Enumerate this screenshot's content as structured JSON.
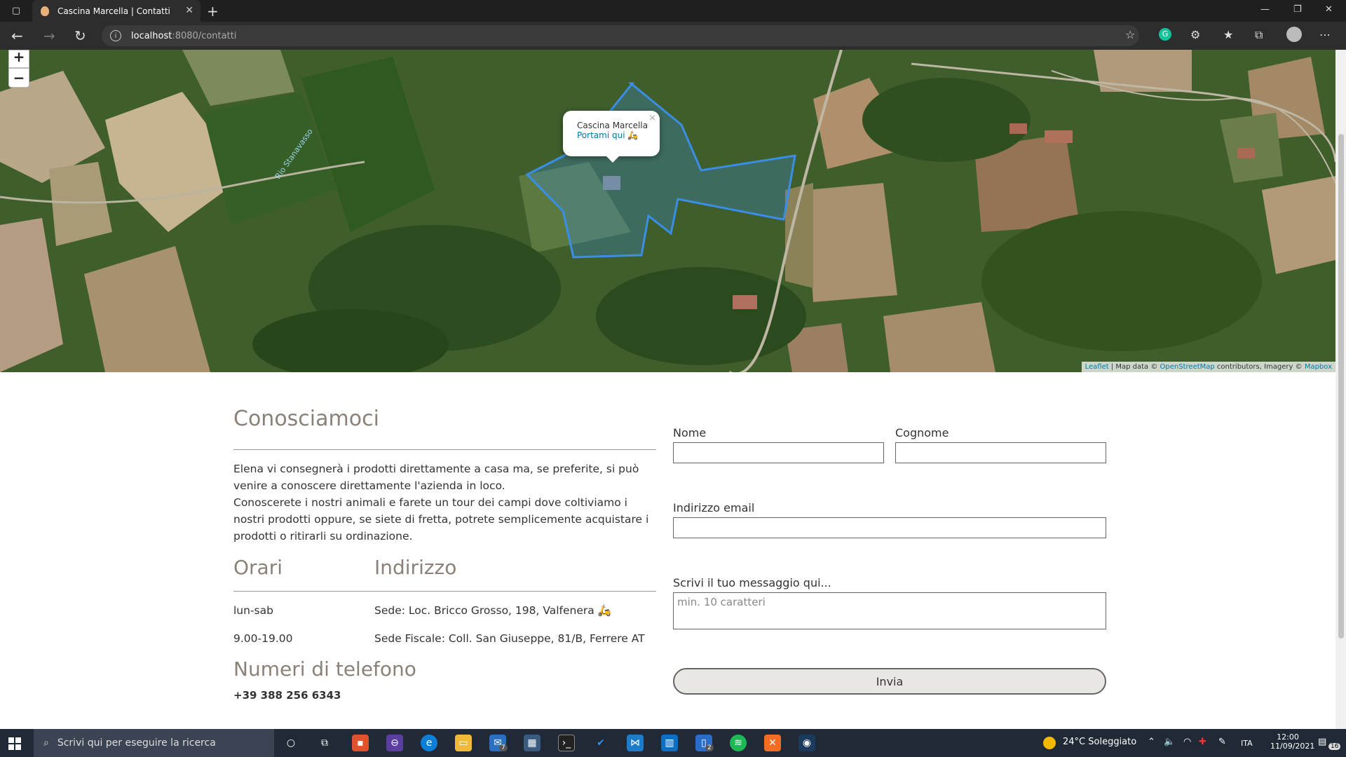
{
  "browser": {
    "tab_title": "Cascina Marcella | Contatti",
    "url_host": "localhost",
    "url_rest": ":8080/contatti"
  },
  "map": {
    "zoom_in": "+",
    "zoom_out": "−",
    "river_label": "Rio Stanavasso",
    "popup_title": "Cascina Marcella",
    "popup_link": "Portami qui 🛵",
    "popup_close": "×",
    "attrib_leaflet": "Leaflet",
    "attrib_mid": " | Map data © ",
    "attrib_osm": "OpenStreetMap",
    "attrib_contrib": " contributors, Imagery © ",
    "attrib_mapbox": "Mapbox"
  },
  "about": {
    "title": "Conosciamoci",
    "paragraph1": "Elena vi consegnerà i prodotti direttamente a casa ma, se preferite, si può venire a conoscere direttamente l'azienda in loco.",
    "paragraph2": "Conoscerete i nostri animali e farete un tour dei campi dove coltiviamo i nostri prodotti oppure, se siete di fretta, potrete semplicemente acquistare i prodotti o ritirarli su ordinazione."
  },
  "info_table": {
    "headers": [
      "Orari",
      "Indirizzo"
    ],
    "rows": [
      [
        "lun-sab",
        "Sede: Loc. Bricco Grosso, 198, Valfenera 🛵"
      ],
      [
        "9.00-19.00",
        "Sede Fiscale: Coll. San Giuseppe, 81/B, Ferrere AT"
      ]
    ]
  },
  "phone": {
    "title": "Numeri di telefono",
    "number": "+39 388 256 6343"
  },
  "form": {
    "nome_label": "Nome",
    "cognome_label": "Cognome",
    "email_label": "Indirizzo email",
    "message_label": "Scrivi il tuo messaggio qui...",
    "message_placeholder": "min. 10 caratteri",
    "submit_label": "Invia"
  },
  "taskbar": {
    "search_placeholder": "Scrivi qui per eseguire la ricerca",
    "weather": "24°C  Soleggiato",
    "lang": "ITA",
    "time": "12:00",
    "date": "11/09/2021",
    "notif_count": "16",
    "mail_badge": "7",
    "notepad_badge": "2"
  },
  "colors": {
    "heading": "#8a8178",
    "link": "#0078a8",
    "polygon": "#3a8ee6"
  }
}
